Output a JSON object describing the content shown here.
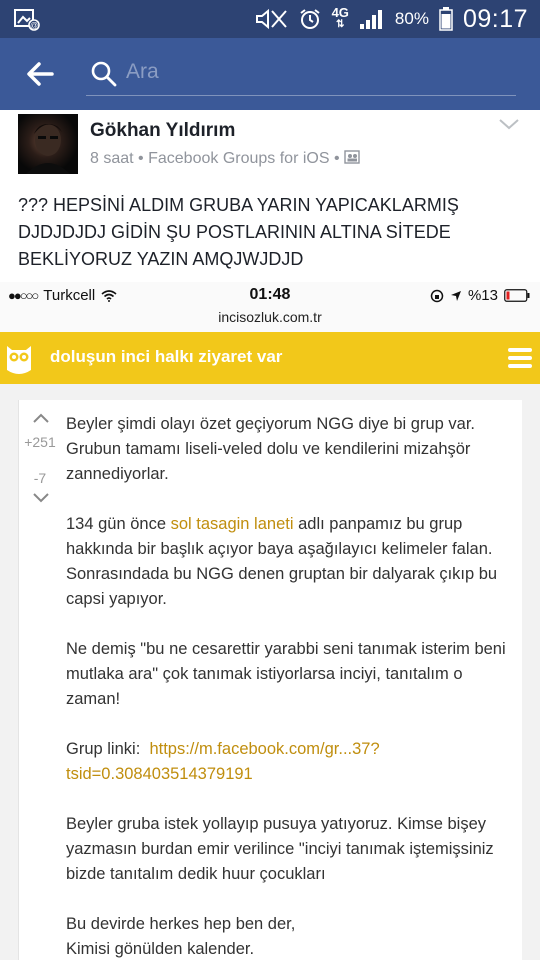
{
  "status_bar": {
    "network": "4G",
    "battery": "80%",
    "time": "09:17"
  },
  "fb_header": {
    "search_placeholder": "Ara"
  },
  "post": {
    "author": "Gökhan Yıldırım",
    "time_ago": "8 saat",
    "source": "Facebook Groups for iOS",
    "separator": "•",
    "text": "??? HEPSİNİ ALDIM GRUBA YARIN YAPICAKLARMIŞ DJDJDJDJ GİDİN ŞU POSTLARININ ALTINA SİTEDE BEKLİYORUZ YAZIN AMQJWJDJD"
  },
  "screenshot": {
    "ios_status": {
      "carrier": "Turkcell",
      "time": "01:48",
      "battery": "%13",
      "url": "incisozluk.com.tr"
    },
    "header_title": "doluşun inci halkı ziyaret var",
    "entry": {
      "upvotes": "+251",
      "downvotes": "-7",
      "p1": "Beyler şimdi olayı özet geçiyorum NGG diye bi grup var. Grubun tamamı liseli-veled dolu ve kendilerini mizahşör zannediyorlar.",
      "p2_prefix": "134 gün önce ",
      "p2_link": "sol tasagin laneti",
      "p2_suffix": " adlı panpamız bu grup hakkında bir başlık açıyor baya aşağılayıcı kelimeler falan. Sonrasındada bu NGG denen gruptan bir dalyarak çıkıp bu capsi yapıyor.",
      "p3": "Ne demiş \"bu ne cesarettir yarabbi seni tanımak isterim beni mutlaka ara\" çok tanımak istiyorlarsa inciyi, tanıtalım o zaman!",
      "p4_label": "Grup linki:  ",
      "p4_link": "https://m.facebook.com/gr...37?tsid=0.308403514379191",
      "p5": "Beyler gruba istek yollayıp pusuya yatıyoruz. Kimse bişey yazmasın burdan emir verilince \"inciyi tanımak iştemişsiniz bizde tanıtalım dedik huur çocukları",
      "p6_line1": "Bu devirde herkes hep ben der,",
      "p6_line2": "Kimisi gönülden kalender."
    }
  },
  "colors": {
    "status_bar": "#2d4373",
    "fb_blue": "#3b5998",
    "inci_yellow": "#f2c81a",
    "link_gold": "#c08e0e"
  }
}
